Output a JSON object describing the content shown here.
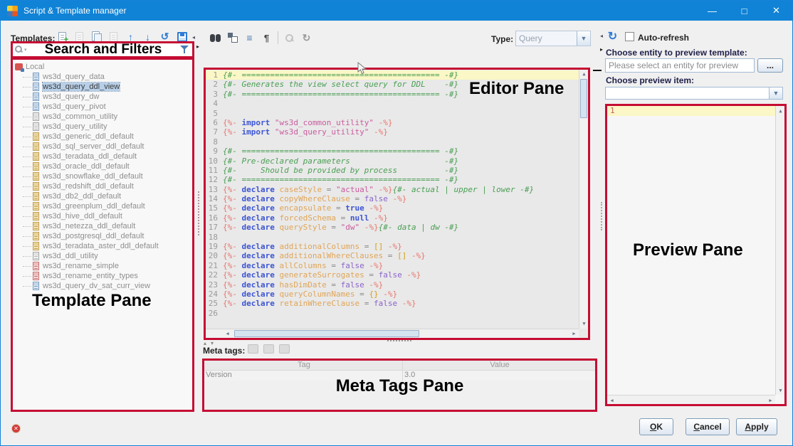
{
  "window": {
    "title": "Script & Template manager"
  },
  "toolbar": {
    "templates_label": "Templates:",
    "template_actions": [
      "new-template",
      "edit-template",
      "copy-template",
      "delete-template",
      "move-up",
      "move-down",
      "revert",
      "save"
    ],
    "editor_actions": [
      "find",
      "replace",
      "format",
      "show-whitespace",
      "preview-search",
      "refresh-disabled"
    ],
    "type_label": "Type:",
    "type_value": "Query",
    "auto_refresh_label": "Auto-refresh",
    "auto_refresh_checked": false
  },
  "annotations": {
    "search": "Search and Filters",
    "template": "Template Pane",
    "editor": "Editor Pane",
    "preview": "Preview Pane",
    "meta": "Meta Tags Pane",
    "box_color": "#c50d33"
  },
  "template_pane": {
    "root": "Local",
    "items": [
      {
        "label": "ws3d_query_data",
        "icon": "blue",
        "selected": false
      },
      {
        "label": "ws3d_query_ddl_view",
        "icon": "blue",
        "selected": true
      },
      {
        "label": "ws3d_query_dw",
        "icon": "blue",
        "selected": false
      },
      {
        "label": "ws3d_query_pivot",
        "icon": "blue",
        "selected": false
      },
      {
        "label": "ws3d_common_utility",
        "icon": "gray",
        "selected": false
      },
      {
        "label": "ws3d_query_utility",
        "icon": "gray",
        "selected": false
      },
      {
        "label": "ws3d_generic_ddl_default",
        "icon": "tan",
        "selected": false
      },
      {
        "label": "ws3d_sql_server_ddl_default",
        "icon": "tan",
        "selected": false
      },
      {
        "label": "ws3d_teradata_ddl_default",
        "icon": "tan",
        "selected": false
      },
      {
        "label": "ws3d_oracle_ddl_default",
        "icon": "tan",
        "selected": false
      },
      {
        "label": "ws3d_snowflake_ddl_default",
        "icon": "tan",
        "selected": false
      },
      {
        "label": "ws3d_redshift_ddl_default",
        "icon": "tan",
        "selected": false
      },
      {
        "label": "ws3d_db2_ddl_default",
        "icon": "tan",
        "selected": false
      },
      {
        "label": "ws3d_greenplum_ddl_default",
        "icon": "tan",
        "selected": false
      },
      {
        "label": "ws3d_hive_ddl_default",
        "icon": "tan",
        "selected": false
      },
      {
        "label": "ws3d_netezza_ddl_default",
        "icon": "tan",
        "selected": false
      },
      {
        "label": "ws3d_postgresql_ddl_default",
        "icon": "tan",
        "selected": false
      },
      {
        "label": "ws3d_teradata_aster_ddl_default",
        "icon": "tan",
        "selected": false
      },
      {
        "label": "ws3d_ddl_utility",
        "icon": "gray",
        "selected": false
      },
      {
        "label": "ws3d_rename_simple",
        "icon": "red",
        "selected": false
      },
      {
        "label": "ws3d_rename_entity_types",
        "icon": "red",
        "selected": false
      },
      {
        "label": "ws3d_query_dv_sat_curr_view",
        "icon": "blue",
        "selected": false
      }
    ]
  },
  "editor": {
    "lines": [
      [
        [
          "cm",
          "{#- ========================================== -#}"
        ]
      ],
      [
        [
          "cm",
          "{#- Generates the view select query for DDL    -#}"
        ]
      ],
      [
        [
          "cm",
          "{#- ========================================== -#}"
        ]
      ],
      [],
      [],
      [
        [
          "dl",
          "{%- "
        ],
        [
          "kw",
          "import"
        ],
        [
          "tx",
          " "
        ],
        [
          "st",
          "\"ws3d_common_utility\""
        ],
        [
          "tx",
          " "
        ],
        [
          "dl",
          "-%}"
        ]
      ],
      [
        [
          "dl",
          "{%- "
        ],
        [
          "kw",
          "import"
        ],
        [
          "tx",
          " "
        ],
        [
          "st",
          "\"ws3d_query_utility\""
        ],
        [
          "tx",
          " "
        ],
        [
          "dl",
          "-%}"
        ]
      ],
      [],
      [
        [
          "cm",
          "{#- ========================================== -#}"
        ]
      ],
      [
        [
          "cm",
          "{#- Pre-declared parameters                    -#}"
        ]
      ],
      [
        [
          "cm",
          "{#-     Should be provided by process          -#}"
        ]
      ],
      [
        [
          "cm",
          "{#- ========================================== -#}"
        ]
      ],
      [
        [
          "dl",
          "{%- "
        ],
        [
          "kw",
          "declare"
        ],
        [
          "tx",
          " "
        ],
        [
          "vr",
          "caseStyle"
        ],
        [
          "op",
          " = "
        ],
        [
          "st",
          "\"actual\""
        ],
        [
          "tx",
          " "
        ],
        [
          "dl",
          "-%}"
        ],
        [
          "cm",
          "{#- actual | upper | lower -#}"
        ]
      ],
      [
        [
          "dl",
          "{%- "
        ],
        [
          "kw",
          "declare"
        ],
        [
          "tx",
          " "
        ],
        [
          "vr",
          "copyWhereClause"
        ],
        [
          "op",
          " = "
        ],
        [
          "bf",
          "false"
        ],
        [
          "tx",
          " "
        ],
        [
          "dl",
          "-%}"
        ]
      ],
      [
        [
          "dl",
          "{%- "
        ],
        [
          "kw",
          "declare"
        ],
        [
          "tx",
          " "
        ],
        [
          "vr",
          "encapsulate"
        ],
        [
          "op",
          " = "
        ],
        [
          "bb",
          "true"
        ],
        [
          "tx",
          " "
        ],
        [
          "dl",
          "-%}"
        ]
      ],
      [
        [
          "dl",
          "{%- "
        ],
        [
          "kw",
          "declare"
        ],
        [
          "tx",
          " "
        ],
        [
          "vr",
          "forcedSchema"
        ],
        [
          "op",
          " = "
        ],
        [
          "bb",
          "null"
        ],
        [
          "tx",
          " "
        ],
        [
          "dl",
          "-%}"
        ]
      ],
      [
        [
          "dl",
          "{%- "
        ],
        [
          "kw",
          "declare"
        ],
        [
          "tx",
          " "
        ],
        [
          "vr",
          "queryStyle"
        ],
        [
          "op",
          " = "
        ],
        [
          "st",
          "\"dw\""
        ],
        [
          "tx",
          " "
        ],
        [
          "dl",
          "-%}"
        ],
        [
          "cm",
          "{#- data | dw -#}"
        ]
      ],
      [],
      [
        [
          "dl",
          "{%- "
        ],
        [
          "kw",
          "declare"
        ],
        [
          "tx",
          " "
        ],
        [
          "vr",
          "additionalColumns"
        ],
        [
          "op",
          " = "
        ],
        [
          "br",
          "[]"
        ],
        [
          "tx",
          " "
        ],
        [
          "dl",
          "-%}"
        ]
      ],
      [
        [
          "dl",
          "{%- "
        ],
        [
          "kw",
          "declare"
        ],
        [
          "tx",
          " "
        ],
        [
          "vr",
          "additionalWhereClauses"
        ],
        [
          "op",
          " = "
        ],
        [
          "br",
          "[]"
        ],
        [
          "tx",
          " "
        ],
        [
          "dl",
          "-%}"
        ]
      ],
      [
        [
          "dl",
          "{%- "
        ],
        [
          "kw",
          "declare"
        ],
        [
          "tx",
          " "
        ],
        [
          "vr",
          "allColumns"
        ],
        [
          "op",
          " = "
        ],
        [
          "bf",
          "false"
        ],
        [
          "tx",
          " "
        ],
        [
          "dl",
          "-%}"
        ]
      ],
      [
        [
          "dl",
          "{%- "
        ],
        [
          "kw",
          "declare"
        ],
        [
          "tx",
          " "
        ],
        [
          "vr",
          "generateSurrogates"
        ],
        [
          "op",
          " = "
        ],
        [
          "bf",
          "false"
        ],
        [
          "tx",
          " "
        ],
        [
          "dl",
          "-%}"
        ]
      ],
      [
        [
          "dl",
          "{%- "
        ],
        [
          "kw",
          "declare"
        ],
        [
          "tx",
          " "
        ],
        [
          "vr",
          "hasDimDate"
        ],
        [
          "op",
          " = "
        ],
        [
          "bf",
          "false"
        ],
        [
          "tx",
          " "
        ],
        [
          "dl",
          "-%}"
        ]
      ],
      [
        [
          "dl",
          "{%- "
        ],
        [
          "kw",
          "declare"
        ],
        [
          "tx",
          " "
        ],
        [
          "vr",
          "queryColumnNames"
        ],
        [
          "op",
          " = "
        ],
        [
          "br",
          "{}"
        ],
        [
          "tx",
          " "
        ],
        [
          "dl",
          "-%}"
        ]
      ],
      [
        [
          "dl",
          "{%- "
        ],
        [
          "kw",
          "declare"
        ],
        [
          "tx",
          " "
        ],
        [
          "vr",
          "retainWhereClause"
        ],
        [
          "op",
          " = "
        ],
        [
          "bf",
          "false"
        ],
        [
          "tx",
          " "
        ],
        [
          "dl",
          "-%}"
        ]
      ],
      []
    ]
  },
  "meta": {
    "label": "Meta tags:",
    "columns": [
      "Tag",
      "Value"
    ],
    "rows": [
      [
        "Version",
        "3.0"
      ]
    ]
  },
  "preview": {
    "entity_label": "Choose entity to preview template:",
    "entity_placeholder": "Please select an entity for preview",
    "browse_label": "...",
    "item_label": "Choose preview item:",
    "line_number": "1"
  },
  "footer": {
    "ok": "OK",
    "cancel": "Cancel",
    "apply": "Apply"
  }
}
